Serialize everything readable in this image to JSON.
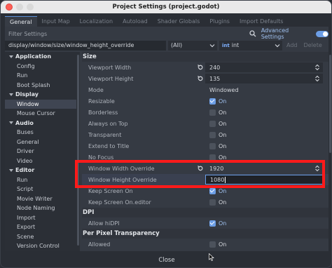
{
  "window": {
    "title": "Project Settings (project.godot)"
  },
  "tabs": [
    "General",
    "Input Map",
    "Localization",
    "Autoload",
    "Shader Globals",
    "Plugins",
    "Import Defaults"
  ],
  "filter": {
    "placeholder": "Filter Settings",
    "advanced_label": "Advanced Settings",
    "advanced_on": true
  },
  "pathbar": {
    "path": "display/window/size/window_height_override",
    "filter_select": "(All)",
    "type_badge": "int",
    "type_select": "int",
    "add_label": "Add",
    "delete_label": "Delete"
  },
  "sidebar": [
    {
      "label": "Application",
      "kind": "cat"
    },
    {
      "label": "Config",
      "kind": "sub"
    },
    {
      "label": "Run",
      "kind": "sub"
    },
    {
      "label": "Boot Splash",
      "kind": "sub"
    },
    {
      "label": "Display",
      "kind": "cat"
    },
    {
      "label": "Window",
      "kind": "sub",
      "selected": true
    },
    {
      "label": "Mouse Cursor",
      "kind": "sub"
    },
    {
      "label": "Audio",
      "kind": "cat"
    },
    {
      "label": "Buses",
      "kind": "sub"
    },
    {
      "label": "General",
      "kind": "sub"
    },
    {
      "label": "Driver",
      "kind": "sub"
    },
    {
      "label": "Video",
      "kind": "sub"
    },
    {
      "label": "Editor",
      "kind": "cat"
    },
    {
      "label": "Run",
      "kind": "sub"
    },
    {
      "label": "Script",
      "kind": "sub"
    },
    {
      "label": "Movie Writer",
      "kind": "sub"
    },
    {
      "label": "Node Naming",
      "kind": "sub"
    },
    {
      "label": "Import",
      "kind": "sub"
    },
    {
      "label": "Export",
      "kind": "sub"
    },
    {
      "label": "Scene",
      "kind": "sub"
    },
    {
      "label": "Version Control",
      "kind": "sub"
    }
  ],
  "props": {
    "size_section": "Size",
    "viewport_width": {
      "label": "Viewport Width",
      "value": "240"
    },
    "viewport_height": {
      "label": "Viewport Height",
      "value": "135"
    },
    "mode": {
      "label": "Mode",
      "value": "Windowed"
    },
    "resizable": {
      "label": "Resizable",
      "value": "On",
      "checked": true
    },
    "borderless": {
      "label": "Borderless",
      "value": "On",
      "checked": false
    },
    "always_on_top": {
      "label": "Always on Top",
      "value": "On",
      "checked": false
    },
    "transparent": {
      "label": "Transparent",
      "value": "On",
      "checked": false
    },
    "extend_to_title": {
      "label": "Extend to Title",
      "value": "On",
      "checked": false
    },
    "no_focus": {
      "label": "No Focus",
      "value": "On",
      "checked": false
    },
    "width_override": {
      "label": "Window Width Override",
      "value": "1920"
    },
    "height_override": {
      "label": "Window Height Override",
      "value": "1080"
    },
    "keep_screen_on": {
      "label": "Keep Screen On",
      "value": "On",
      "checked": true
    },
    "keep_screen_on_editor": {
      "label": "Keep Screen On.editor",
      "value": "On",
      "checked": false
    },
    "dpi_section": "DPI",
    "allow_hidpi": {
      "label": "Allow hiDPI",
      "value": "On",
      "checked": true
    },
    "ppt_section": "Per Pixel Transparency",
    "allowed": {
      "label": "Allowed",
      "value": "On",
      "checked": false
    }
  },
  "footer": {
    "close_label": "Close"
  },
  "colors": {
    "accent": "#6c9ee6",
    "highlight_frame": "#ff1a1a",
    "panel": "#353a43"
  }
}
